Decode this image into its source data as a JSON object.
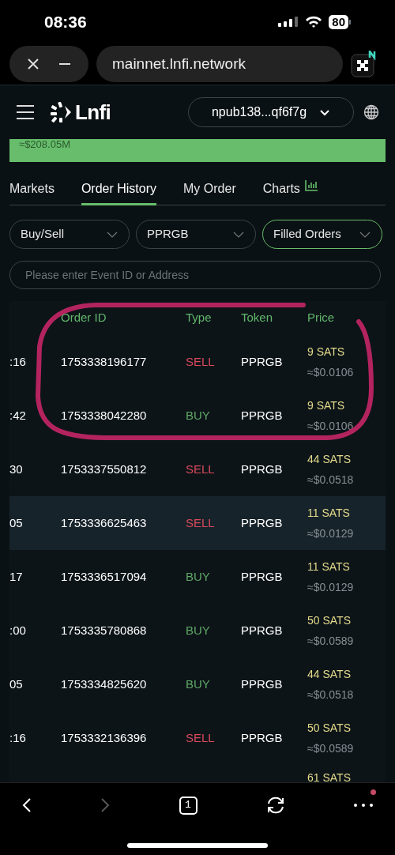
{
  "status_bar": {
    "time": "08:36",
    "battery": "80"
  },
  "browser": {
    "url": "mainnet.lnfi.network",
    "tab_count": "1"
  },
  "header": {
    "logo": "Lnfi",
    "account": "npub138...qf6f7g"
  },
  "banner": {
    "value": "≈$208.05M"
  },
  "tabs": [
    {
      "label": "Markets",
      "selected": false,
      "kind": "text"
    },
    {
      "label": "Order History",
      "selected": true,
      "kind": "text"
    },
    {
      "label": "My Order",
      "selected": false,
      "kind": "text"
    },
    {
      "label": "Charts",
      "selected": false,
      "kind": "chart"
    }
  ],
  "filters": [
    {
      "label": "Buy/Sell",
      "active": false
    },
    {
      "label": "PPRGB",
      "active": false
    },
    {
      "label": "Filled Orders",
      "active": true
    }
  ],
  "search": {
    "placeholder": "Please enter Event ID or Address"
  },
  "table": {
    "columns": [
      "Order ID",
      "Type",
      "Token",
      "Price"
    ],
    "rows": [
      {
        "time": ":16",
        "order_id": "1753338196177",
        "type": "SELL",
        "kind": "sell",
        "token": "PPRGB",
        "price": "9 SATS",
        "usd": "≈$0.0106",
        "selected": false
      },
      {
        "time": ":42",
        "order_id": "1753338042280",
        "type": "BUY",
        "kind": "buy",
        "token": "PPRGB",
        "price": "9 SATS",
        "usd": "≈$0.0106",
        "selected": false
      },
      {
        "time": "30",
        "order_id": "1753337550812",
        "type": "SELL",
        "kind": "sell",
        "token": "PPRGB",
        "price": "44 SATS",
        "usd": "≈$0.0518",
        "selected": false
      },
      {
        "time": "05",
        "order_id": "1753336625463",
        "type": "SELL",
        "kind": "sell",
        "token": "PPRGB",
        "price": "11 SATS",
        "usd": "≈$0.0129",
        "selected": true
      },
      {
        "time": "17",
        "order_id": "1753336517094",
        "type": "BUY",
        "kind": "buy",
        "token": "PPRGB",
        "price": "11 SATS",
        "usd": "≈$0.0129",
        "selected": false
      },
      {
        "time": ":00",
        "order_id": "1753335780868",
        "type": "BUY",
        "kind": "buy",
        "token": "PPRGB",
        "price": "50 SATS",
        "usd": "≈$0.0589",
        "selected": false
      },
      {
        "time": "05",
        "order_id": "1753334825620",
        "type": "BUY",
        "kind": "buy",
        "token": "PPRGB",
        "price": "44 SATS",
        "usd": "≈$0.0518",
        "selected": false
      },
      {
        "time": ":16",
        "order_id": "1753332136396",
        "type": "SELL",
        "kind": "sell",
        "token": "PPRGB",
        "price": "50 SATS",
        "usd": "≈$0.0589",
        "selected": false
      }
    ],
    "partial_row": {
      "price": "61 SATS"
    }
  },
  "toolbar": {
    "forward_disabled": true,
    "more_notification": true
  }
}
